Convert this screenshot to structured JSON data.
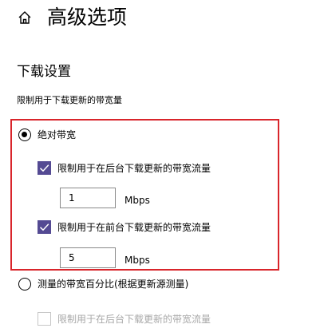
{
  "header": {
    "home_icon": "home-icon",
    "title": "高级选项"
  },
  "download_settings": {
    "title": "下载设置",
    "subtitle": "限制用于下载更新的带宽量",
    "options": [
      {
        "label": "绝对带宽",
        "selected": true,
        "sub_options": [
          {
            "label": "限制用于在后台下载更新的带宽流量",
            "checked": true,
            "value": "1",
            "unit": "Mbps"
          },
          {
            "label": "限制用于在前台下载更新的带宽流量",
            "checked": true,
            "value": "5",
            "unit": "Mbps"
          }
        ]
      },
      {
        "label": "测量的带宽百分比(根据更新源测量)",
        "selected": false,
        "sub_options": [
          {
            "label": "限制用于在后台下载更新的带宽流量",
            "checked": false,
            "disabled": true
          }
        ]
      }
    ]
  },
  "colors": {
    "checkbox_accent": "#544a93",
    "highlight_border": "#d9252b",
    "disabled_text": "#a8a8a8"
  }
}
